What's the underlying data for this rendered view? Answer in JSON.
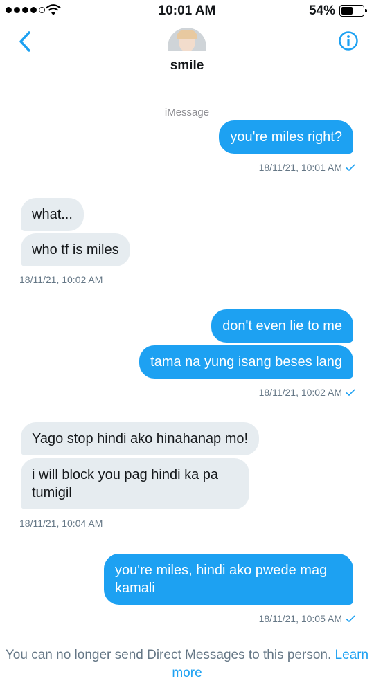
{
  "status_bar": {
    "time": "10:01 AM",
    "battery_pct": "54%",
    "battery_level": 0.54
  },
  "header": {
    "contact_name": "smile"
  },
  "thread": {
    "service_label": "iMessage",
    "messages": [
      {
        "side": "sent",
        "text": "you're miles right?"
      },
      {
        "side": "received",
        "text": "what..."
      },
      {
        "side": "received",
        "text": "who tf is miles"
      },
      {
        "side": "sent",
        "text": "don't even lie to me"
      },
      {
        "side": "sent",
        "text": "tama na yung isang beses lang"
      },
      {
        "side": "received",
        "text": "Yago stop hindi ako hinahanap mo!"
      },
      {
        "side": "received",
        "text": "i will block you pag hindi ka pa tumigil"
      },
      {
        "side": "sent",
        "text": "you're miles, hindi ako pwede mag kamali"
      }
    ],
    "timestamps": [
      "18/11/21, 10:01 AM",
      "18/11/21, 10:02 AM",
      "18/11/21, 10:02 AM",
      "18/11/21, 10:04 AM",
      "18/11/21, 10:05 AM"
    ]
  },
  "footer": {
    "notice": "You can no longer send Direct Messages to this person.",
    "link": "Learn more"
  },
  "colors": {
    "accent": "#1da1f2",
    "received_bubble": "#e6ecf0",
    "meta_text": "#657786"
  },
  "icons": [
    "back-chevron-icon",
    "info-icon",
    "read-check-icon",
    "wifi-icon",
    "battery-icon"
  ]
}
